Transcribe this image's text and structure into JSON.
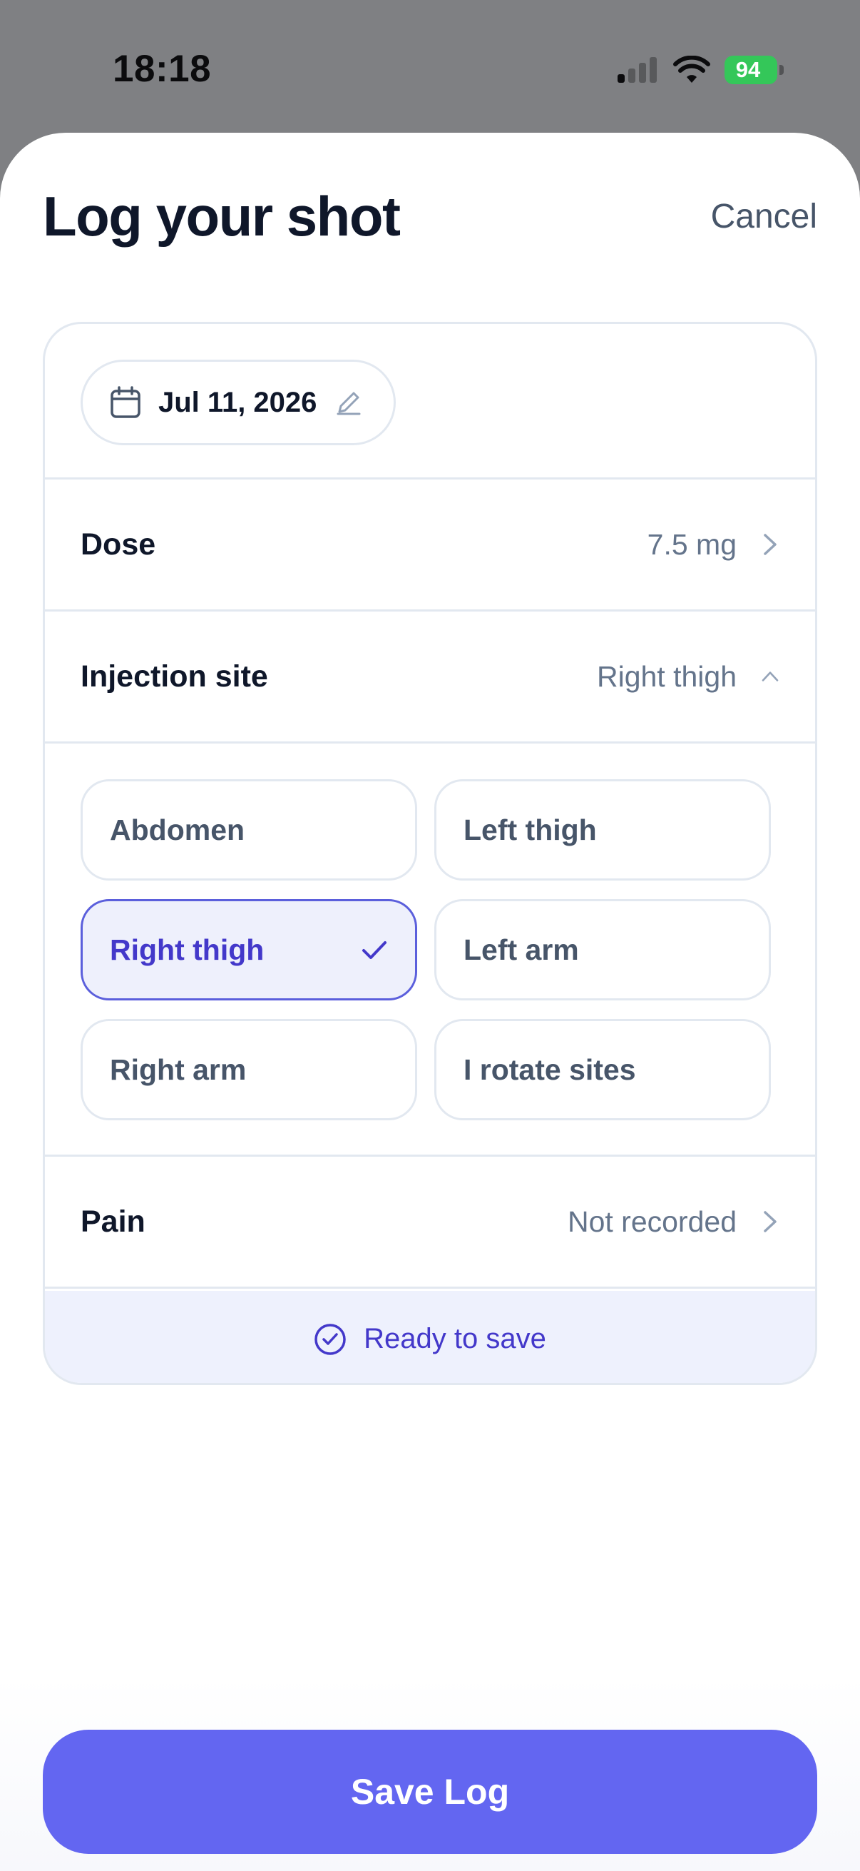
{
  "status_bar": {
    "time": "18:18",
    "battery_percent": "94"
  },
  "sheet": {
    "title": "Log your shot",
    "cancel_label": "Cancel"
  },
  "date": {
    "value": "Jul 11, 2026"
  },
  "dose": {
    "label": "Dose",
    "value": "7.5 mg"
  },
  "injection_site": {
    "label": "Injection site",
    "value": "Right thigh",
    "options": [
      {
        "label": "Abdomen",
        "selected": false
      },
      {
        "label": "Left thigh",
        "selected": false
      },
      {
        "label": "Right thigh",
        "selected": true
      },
      {
        "label": "Left arm",
        "selected": false
      },
      {
        "label": "Right arm",
        "selected": false
      },
      {
        "label": "I rotate sites",
        "selected": false
      }
    ]
  },
  "pain": {
    "label": "Pain",
    "value": "Not recorded"
  },
  "status": {
    "ready_text": "Ready to save"
  },
  "save_label": "Save Log",
  "colors": {
    "accent": "#6366f1",
    "selected_text": "#4338ca",
    "selected_bg": "#eef0fc",
    "battery": "#34c759"
  }
}
